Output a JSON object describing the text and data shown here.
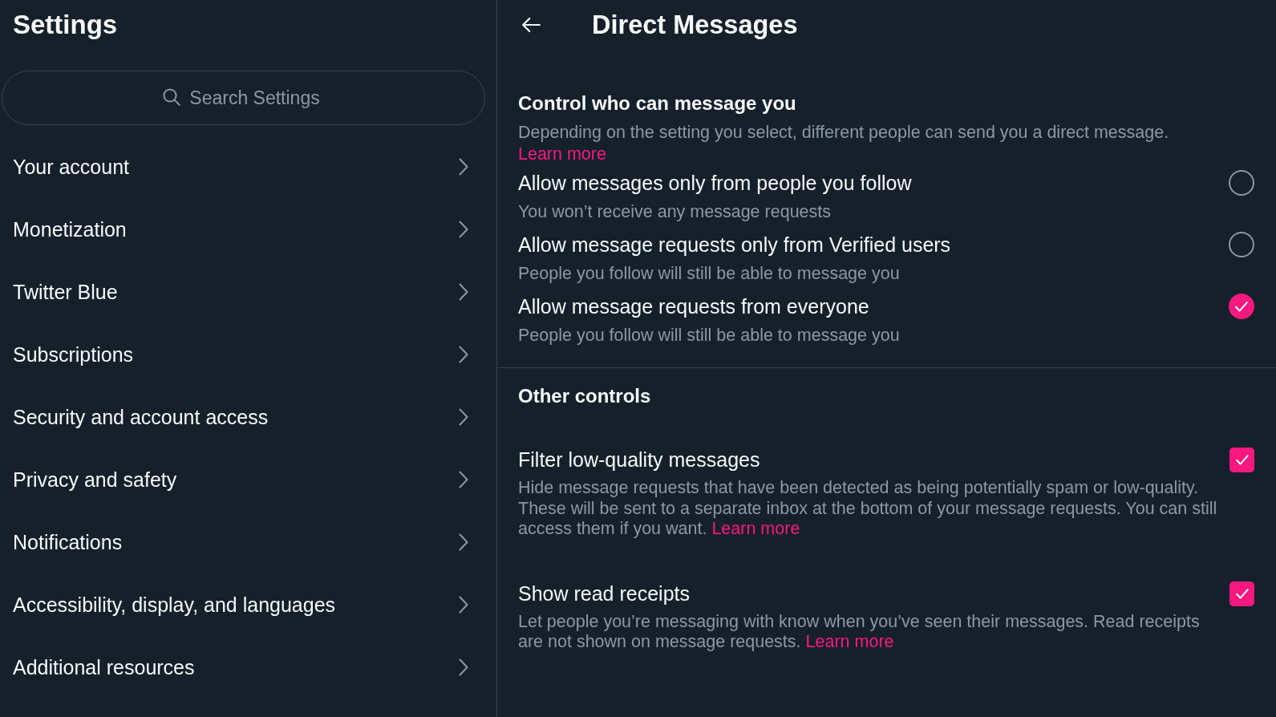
{
  "sidebar": {
    "title": "Settings",
    "search": {
      "placeholder": "Search Settings"
    },
    "items": [
      {
        "label": "Your account",
        "selected": false
      },
      {
        "label": "Monetization",
        "selected": false
      },
      {
        "label": "Twitter Blue",
        "selected": false
      },
      {
        "label": "Subscriptions",
        "selected": false
      },
      {
        "label": "Security and account access",
        "selected": false
      },
      {
        "label": "Privacy and safety",
        "selected": false
      },
      {
        "label": "Notifications",
        "selected": false
      },
      {
        "label": "Accessibility, display, and languages",
        "selected": false
      },
      {
        "label": "Additional resources",
        "selected": false
      }
    ]
  },
  "main": {
    "title": "Direct Messages",
    "message_control": {
      "heading": "Control who can message you",
      "description": "Depending on the setting you select, different people can send you a direct message.",
      "link": "Learn more",
      "options": [
        {
          "label": "Allow messages only from people you follow",
          "description": "You won’t receive any message requests",
          "selected": false
        },
        {
          "label": "Allow message requests only from Verified users",
          "description": "People you follow will still be able to message you",
          "selected": false
        },
        {
          "label": "Allow message requests from everyone",
          "description": "People you follow will still be able to message you",
          "selected": true
        }
      ]
    },
    "other_controls": {
      "heading": "Other controls",
      "settings": [
        {
          "label": "Filter low-quality messages",
          "description": "Hide message requests that have been detected as being potentially spam or low-quality. These will be sent to a separate inbox at the bottom of your message requests. You can still access them if you want.",
          "link": "Learn more",
          "checked": true
        },
        {
          "label": "Show read receipts",
          "description": "Let people you’re messaging with know when you’ve seen their messages. Read receipts are not shown on message requests.",
          "link": "Learn more",
          "checked": true
        }
      ]
    }
  }
}
